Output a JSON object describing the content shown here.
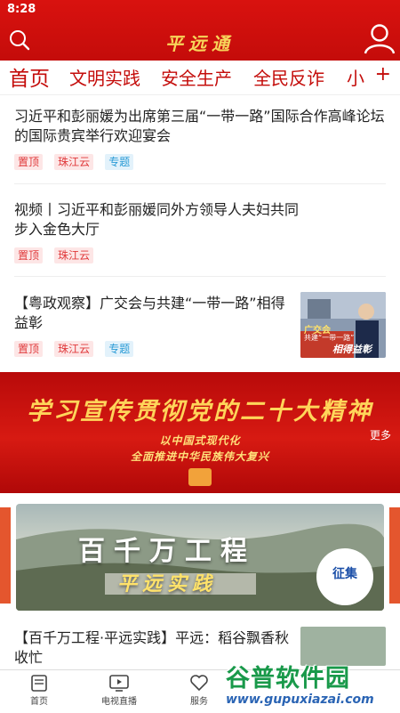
{
  "status": {
    "time": "8:28"
  },
  "header": {
    "logo": "平远通"
  },
  "tabs": [
    "首页",
    "文明实践",
    "安全生产",
    "全民反诈",
    "小"
  ],
  "tabs_more": "+",
  "news": [
    {
      "title": "习近平和彭丽媛为出席第三届“一带一路”国际合作高峰论坛的国际贵宾举行欢迎宴会",
      "tags": [
        "置顶",
        "珠江云",
        "专题"
      ]
    },
    {
      "title": "视频丨习近平和彭丽媛同外方领导人夫妇共同步入金色大厅",
      "tags": [
        "置顶",
        "珠江云"
      ]
    },
    {
      "title": "【粤政观察】广交会与共建“一带一路”相得益彰",
      "tags": [
        "置顶",
        "珠江云",
        "专题"
      ],
      "thumb_caption": "相得益彰",
      "thumb_label1": "广交会",
      "thumb_label2": "共建“一带一路”"
    },
    {
      "title": "【百千万工程·平远实践】平远：稻谷飘香秋收忙"
    }
  ],
  "banner": {
    "title": "学习宣传贯彻党的二十大精神",
    "subtitle1": "以中国式现代化",
    "subtitle2": "全面推进中华民族伟大复兴",
    "more": "更多"
  },
  "carousel": {
    "title": "百千万工程",
    "subtitle": "平远实践",
    "circle_text": "征集"
  },
  "tabbar": [
    {
      "label": "首页",
      "icon": "news-icon"
    },
    {
      "label": "电视直播",
      "icon": "tv-icon"
    },
    {
      "label": "服务",
      "icon": "heart-icon"
    }
  ],
  "watermark": {
    "name": "谷普软件园",
    "url": "www.gupuxiazai.com"
  },
  "colors": {
    "brand_red": "#c40c0a",
    "tag_red": "#e0393b",
    "tag_blue": "#2a9bd6"
  }
}
